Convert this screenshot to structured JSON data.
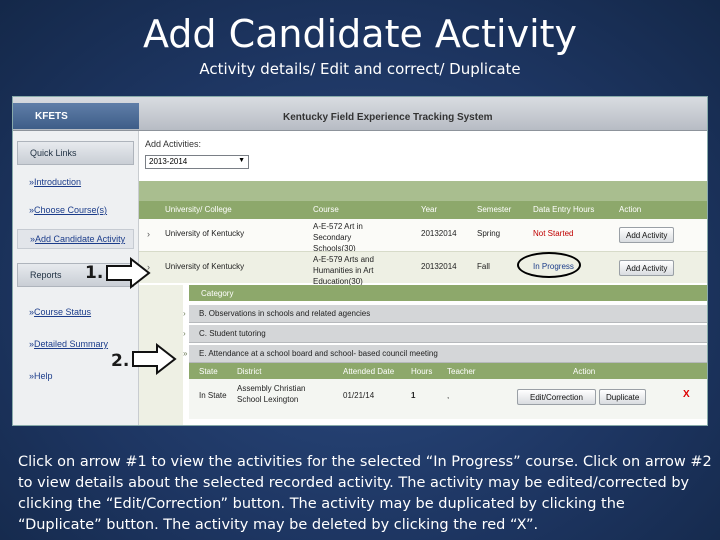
{
  "slide": {
    "title": "Add Candidate Activity",
    "subtitle": "Activity details/ Edit and correct/ Duplicate",
    "caption": "Click on arrow #1 to view the activities for the selected “In Progress” course. Click on arrow #2 to view details about the selected recorded activity. The activity may be edited/corrected by clicking the “Edit/Correction” button. The activity may be duplicated by clicking the “Duplicate” button. The activity may be deleted by clicking the red “X”."
  },
  "app": {
    "brand": "KFETS",
    "title": "Kentucky Field Experience Tracking System"
  },
  "sidebar": {
    "quick_links_heading": "Quick Links",
    "links": [
      "Introduction",
      "Choose Course(s)",
      "Add Candidate Activity"
    ],
    "reports_heading": "Reports",
    "report_links": [
      "Course Status",
      "Detailed Summary",
      "Help"
    ],
    "bullet": "»"
  },
  "main": {
    "add_activities_label": "Add Activities:",
    "year_selected": "2013-2014",
    "columns": {
      "university": "University/ College",
      "course": "Course",
      "year": "Year",
      "semester": "Semester",
      "data_entry_hours": "Data Entry Hours",
      "action": "Action"
    },
    "rows": [
      {
        "university": "University of Kentucky",
        "course": "A-E-572 Art in Secondary Schools(30)",
        "year": "20132014",
        "semester": "Spring",
        "status": "Not Started",
        "action": "Add Activity"
      },
      {
        "university": "University of Kentucky",
        "course": "A-E-579 Arts and Humanities in Art Education(30)",
        "year": "20132014",
        "semester": "Fall",
        "status": "In Progress",
        "action": "Add Activity"
      }
    ],
    "category_heading": "Category",
    "categories": [
      "B. Observations in schools and related agencies",
      "C. Student tutoring",
      "E. Attendance at a school board and school- based council meeting"
    ],
    "detail_columns": {
      "state": "State",
      "district": "District",
      "attended_date": "Attended Date",
      "hours": "Hours",
      "teacher": "Teacher",
      "action": "Action"
    },
    "detail_row": {
      "state": "In State",
      "district": "Assembly Christian School Lexington",
      "attended_date": "01/21/14",
      "hours": "1",
      "teacher": ",",
      "edit_label": "Edit/Correction",
      "duplicate_label": "Duplicate",
      "delete_label": "X"
    }
  },
  "annotations": {
    "arrow1": "1.",
    "arrow2": "2."
  }
}
